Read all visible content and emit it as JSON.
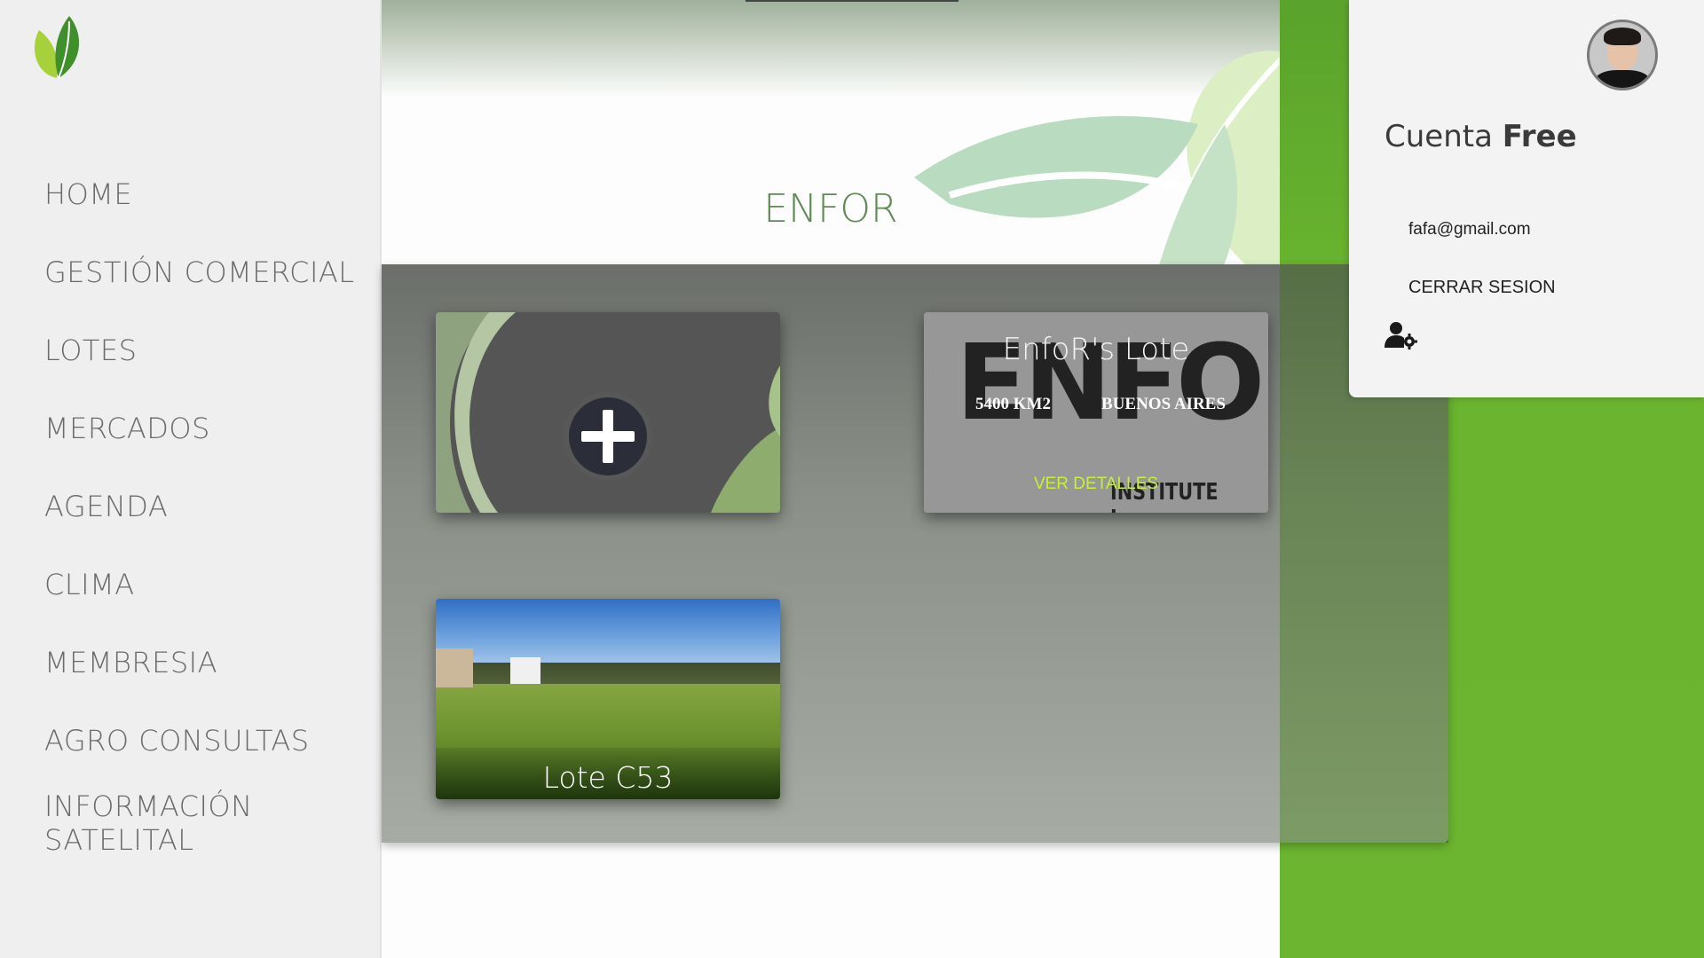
{
  "sidebar": {
    "logo": "leaf-logo",
    "items": [
      {
        "label": "HOME"
      },
      {
        "label": "GESTIÓN COMERCIAL"
      },
      {
        "label": "LOTES"
      },
      {
        "label": "MERCADOS"
      },
      {
        "label": "AGENDA"
      },
      {
        "label": "CLIMA"
      },
      {
        "label": "MEMBRESIA"
      },
      {
        "label": "AGRO CONSULTAS"
      },
      {
        "label": "INFORMACIÓN"
      },
      {
        "label": "SATELITAL"
      }
    ]
  },
  "main": {
    "title": "ENFOR",
    "cards": [
      {
        "type": "add",
        "icon": "plus-icon"
      },
      {
        "type": "lote",
        "title": "EnfoR's Lote",
        "size": "5400 KM2",
        "region": "BUENOS AIRES",
        "details_label": "VER DETALLES",
        "logo_text": "ENFOR",
        "logo_subtext": "INSTITUTE Inc."
      },
      {
        "type": "lote",
        "title": "Lote C53"
      }
    ]
  },
  "account": {
    "title_prefix": "Cuenta",
    "plan": "Free",
    "email": "fafa@gmail.com",
    "logout_label": "CERRAR SESION",
    "settings_icon": "user-gear-icon"
  },
  "colors": {
    "accent_green": "#6cb530",
    "title_green": "#5f8a55",
    "details_link": "#c6f03a",
    "sidebar_bg": "#efefef"
  }
}
